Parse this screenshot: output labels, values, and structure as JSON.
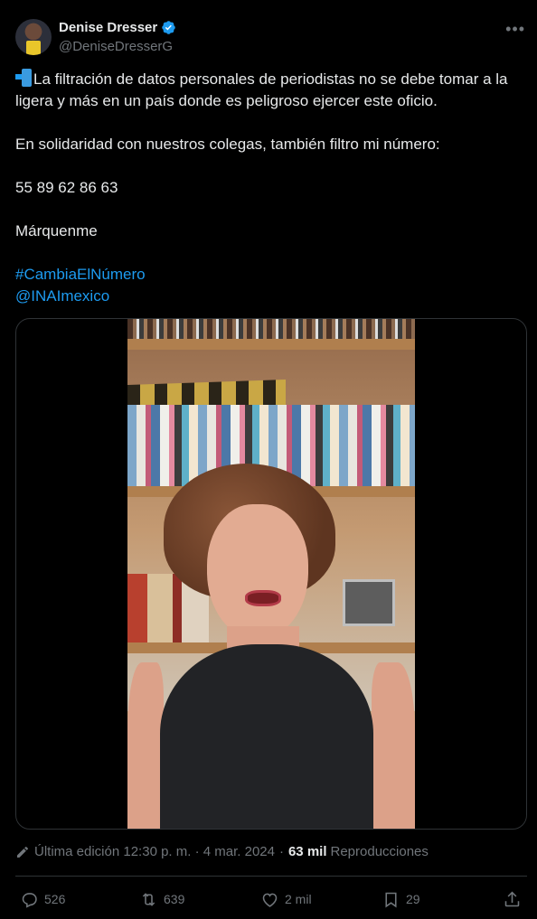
{
  "author": {
    "display_name": "Denise Dresser",
    "handle": "@DeniseDresserG",
    "verified": true
  },
  "more_icon": "more-horizontal-icon",
  "tweet": {
    "line1": "La filtración de datos personales de periodistas no se debe tomar a la ligera y más en un país donde es peligroso ejercer este oficio.",
    "line2": "En solidaridad con nuestros colegas, también filtro mi número:",
    "phone": "55 89 62 86 63",
    "line4": "Márquenme",
    "hashtag": "#CambiaElNúmero",
    "mention": "@INAImexico",
    "leading_emoji": "mobile-phone-with-arrow-icon"
  },
  "meta": {
    "edited_label": "Última edición 12:30 p. m. · 4 mar. 2024",
    "separator": "·",
    "views_count": "63 mil",
    "views_label": "Reproducciones"
  },
  "actions": {
    "replies": "526",
    "reposts": "639",
    "likes": "2 mil",
    "bookmarks": "29"
  },
  "colors": {
    "background": "#000000",
    "text": "#e7e9ea",
    "secondary": "#71767b",
    "link": "#1d9bf0",
    "border": "#2f3336"
  }
}
